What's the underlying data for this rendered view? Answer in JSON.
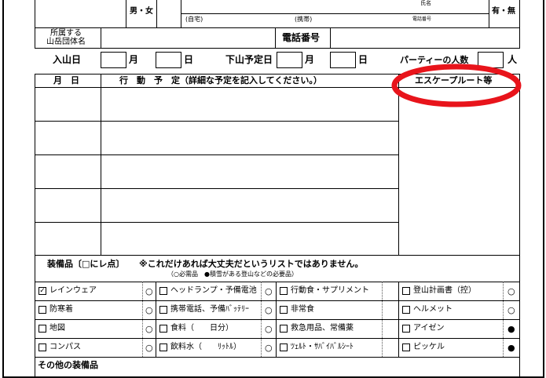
{
  "header": {
    "sex": "男・女",
    "name_label": "氏名",
    "home_label": "(自宅)",
    "mobile_label": "(携帯)",
    "phone_number_label": "電話番号",
    "yes_no": "有・無"
  },
  "org": {
    "label_line1": "所属する",
    "label_line2": "山岳団体名",
    "phone_label": "電話番号"
  },
  "dates": {
    "enter_label": "入山日",
    "month": "月",
    "day": "日",
    "exit_label": "下山予定日",
    "party_label": "パーティーの人数",
    "people_unit": "人"
  },
  "schedule": {
    "col_date": "月　日",
    "col_plan": "行　動　予　定（詳細な予定を記入してください。）",
    "col_escape": "エスケープルート等"
  },
  "equipment": {
    "title": "装備品〔□にレ点〕",
    "note": "※これだけあれば大丈夫だというリストではありません。",
    "legend": "（○必需品　●積雪がある登山などの必要品）",
    "items": [
      {
        "label": "レインウェア",
        "checked": "✓",
        "mark": "○"
      },
      {
        "label": "ヘッドランプ・予備電池",
        "checked": "",
        "mark": "○"
      },
      {
        "label": "行動食・サプリメント",
        "checked": "",
        "mark": ""
      },
      {
        "label": "登山計画書（控）",
        "checked": "",
        "mark": "○"
      },
      {
        "label": "防寒着",
        "checked": "",
        "mark": "○"
      },
      {
        "label": "携帯電話、予備ﾊﾞｯﾃﾘｰ",
        "checked": "",
        "mark": "○"
      },
      {
        "label": "非常食",
        "checked": "",
        "mark": ""
      },
      {
        "label": "ヘルメット",
        "checked": "",
        "mark": "○"
      },
      {
        "label": "地図",
        "checked": "",
        "mark": "○"
      },
      {
        "label": "食料（　　日分）",
        "checked": "",
        "mark": "○"
      },
      {
        "label": "救急用品、常備薬",
        "checked": "",
        "mark": ""
      },
      {
        "label": "アイゼン",
        "checked": "",
        "mark": "●"
      },
      {
        "label": "コンパス",
        "checked": "",
        "mark": "○"
      },
      {
        "label": "飲料水（　　ﾘｯﾄﾙ）",
        "checked": "",
        "mark": "○"
      },
      {
        "label": "ﾂｪﾙﾄ・ｻﾊﾞｲﾊﾞﾙｼｰﾄ",
        "checked": "",
        "mark": ""
      },
      {
        "label": "ピッケル",
        "checked": "",
        "mark": "●"
      }
    ],
    "other_label": "その他の装備品"
  },
  "annotation": {
    "color": "#e8141b"
  }
}
